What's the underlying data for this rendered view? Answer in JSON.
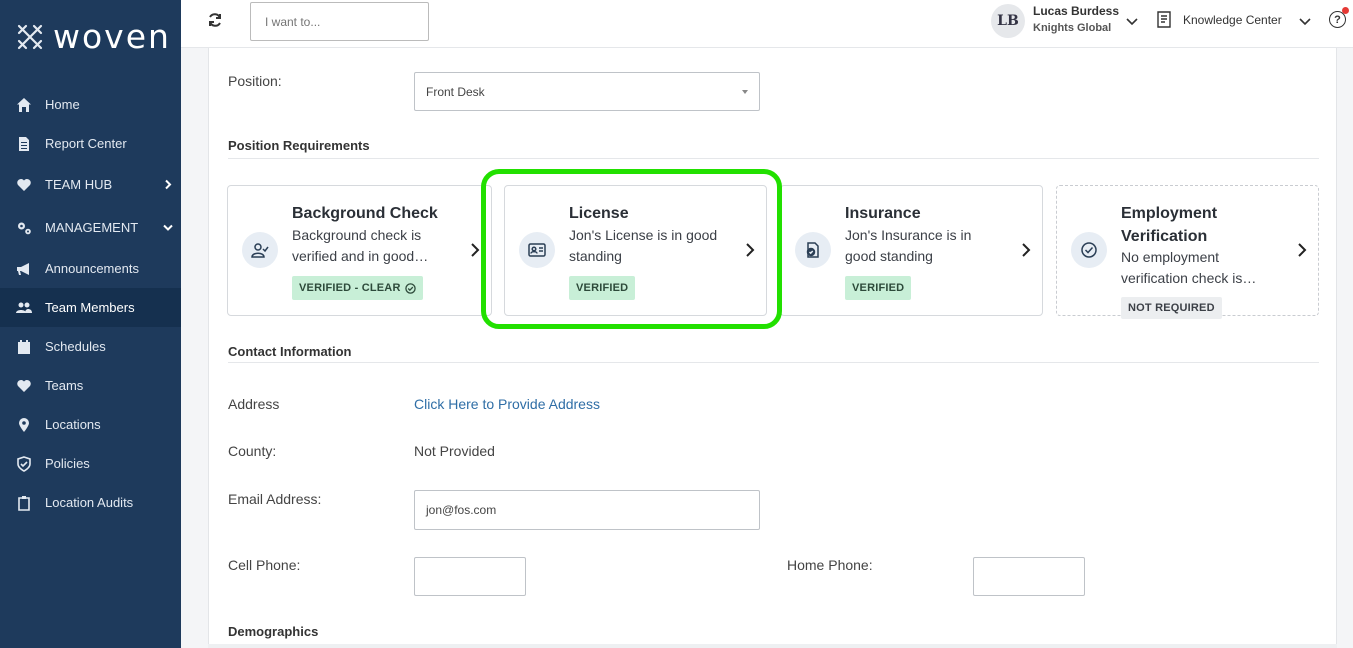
{
  "brand": {
    "name": "woven"
  },
  "sidebar": {
    "items": [
      {
        "label": "Home",
        "icon": "home-icon"
      },
      {
        "label": "Report Center",
        "icon": "document-icon"
      },
      {
        "label": "TEAM HUB",
        "icon": "heart-icon"
      },
      {
        "label": "MANAGEMENT",
        "icon": "cogs-icon"
      },
      {
        "label": "Announcements",
        "icon": "megaphone-icon"
      },
      {
        "label": "Team Members",
        "icon": "users-icon"
      },
      {
        "label": "Schedules",
        "icon": "calendar-icon"
      },
      {
        "label": "Teams",
        "icon": "heart-icon"
      },
      {
        "label": "Locations",
        "icon": "map-pin-icon"
      },
      {
        "label": "Policies",
        "icon": "shield-check-icon"
      },
      {
        "label": "Location Audits",
        "icon": "clipboard-icon"
      }
    ]
  },
  "topbar": {
    "search_placeholder": "I want to...",
    "user_initials": "LB",
    "user_name": "Lucas Burdess",
    "user_org": "Knights Global",
    "knowledge_center": "Knowledge Center",
    "help_symbol": "?"
  },
  "form": {
    "position_label": "Position:",
    "position_value": "Front Desk"
  },
  "requirements": {
    "title": "Position Requirements",
    "cards": [
      {
        "title": "Background Check",
        "description": "Background check is verified and in good…",
        "badge": "VERIFIED - CLEAR",
        "icon": "user-check-icon"
      },
      {
        "title": "License",
        "description": "Jon's License is in good standing",
        "badge": "VERIFIED",
        "icon": "id-card-icon"
      },
      {
        "title": "Insurance",
        "description": "Jon's Insurance is in good standing",
        "badge": "VERIFIED",
        "icon": "insurance-doc-icon"
      },
      {
        "title": "Employment Verification",
        "description": "No employment verification check is…",
        "badge": "NOT REQUIRED",
        "icon": "check-circle-icon"
      }
    ]
  },
  "contact": {
    "title": "Contact Information",
    "address_label": "Address",
    "address_link": "Click Here to Provide Address",
    "county_label": "County:",
    "county_value": "Not Provided",
    "email_label": "Email Address:",
    "email_value": "jon@fos.com",
    "cell_label": "Cell Phone:",
    "cell_value": "",
    "home_label": "Home Phone:",
    "home_value": ""
  },
  "demographics": {
    "title": "Demographics"
  },
  "colors": {
    "sidebar_bg": "#1e3a5c",
    "highlight": "#22e000",
    "badge_green": "#c8efd7",
    "link": "#2f6ea6"
  }
}
